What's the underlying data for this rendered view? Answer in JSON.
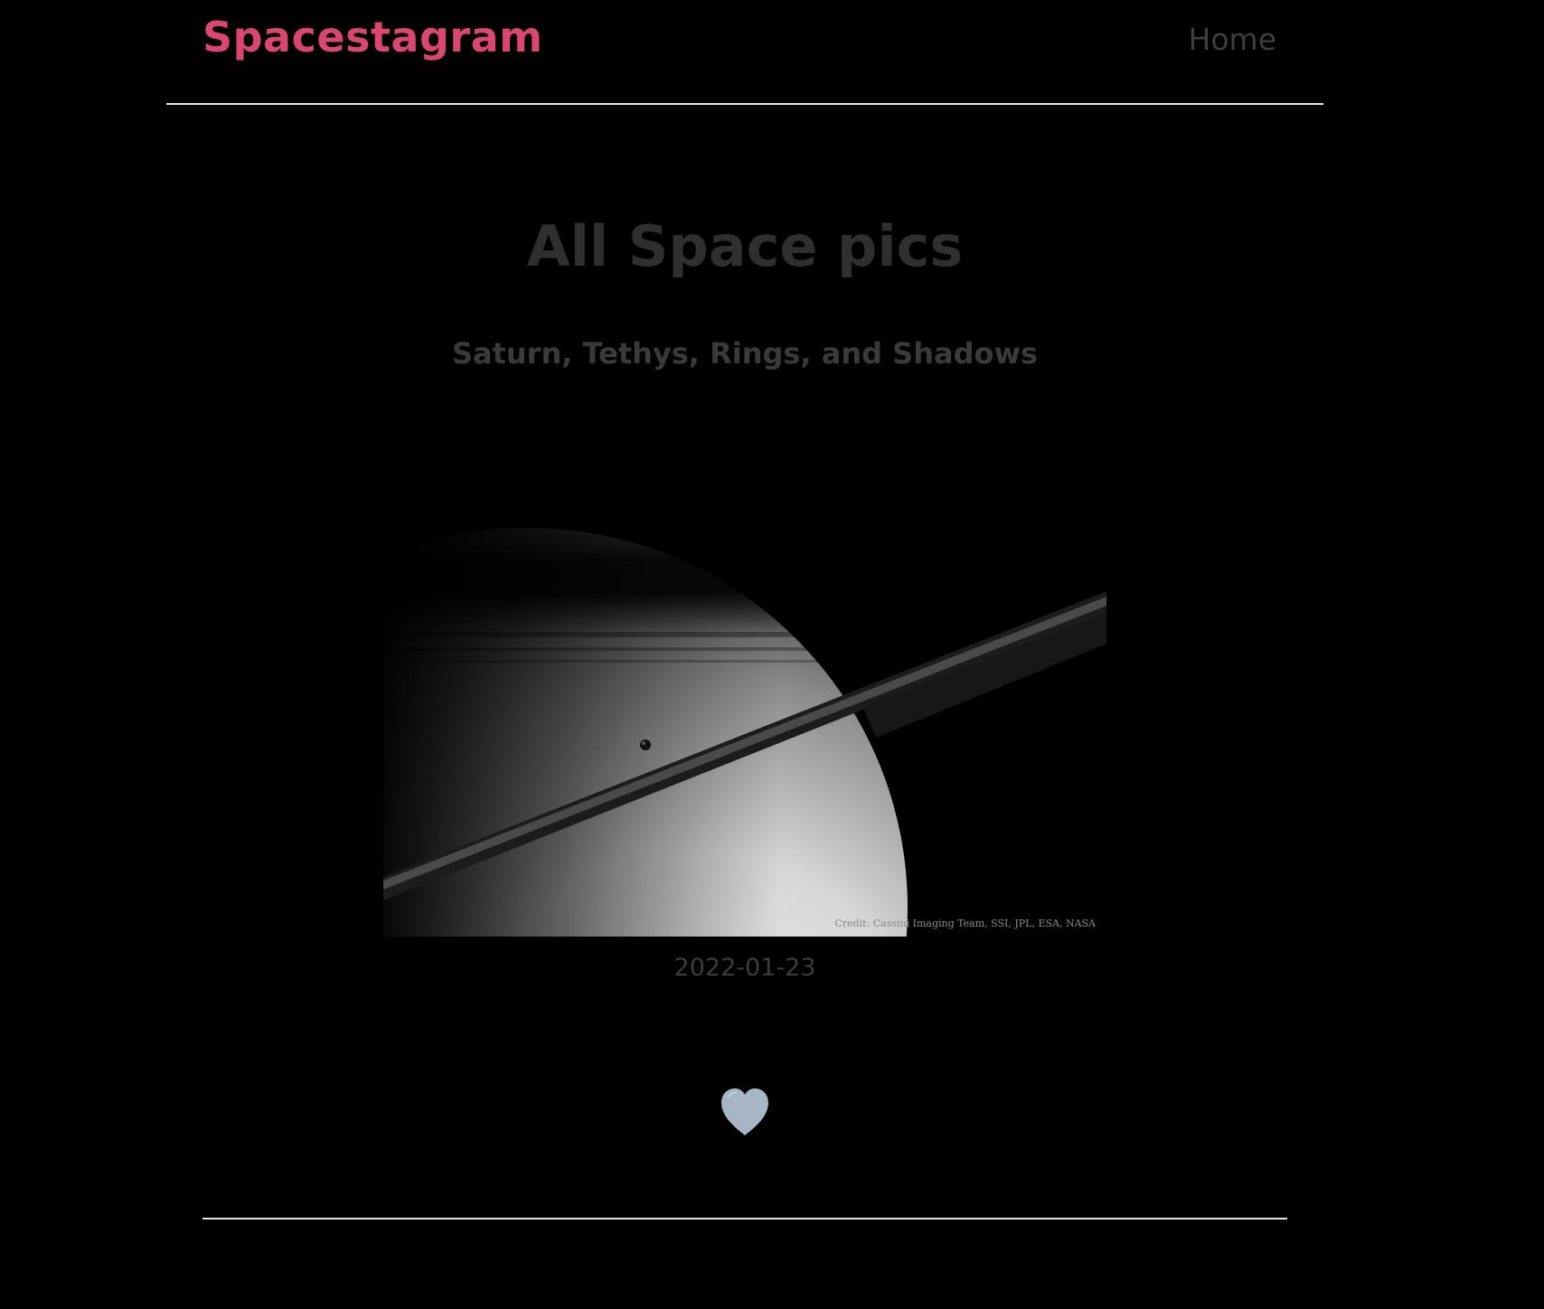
{
  "navbar": {
    "brand": "Spacestagram",
    "home_link": "Home"
  },
  "colors": {
    "brand": "#d9466f",
    "background": "#000000",
    "heart": "#a7b6c4"
  },
  "main": {
    "title": "All Space pics",
    "posts": [
      {
        "title": "Saturn, Tethys, Rings, and Shadows",
        "image_credit": "Credit: Cassini Imaging Team, SSI, JPL, ESA, NASA",
        "date": "2022-01-23",
        "like_icon": "heart-icon"
      }
    ]
  }
}
